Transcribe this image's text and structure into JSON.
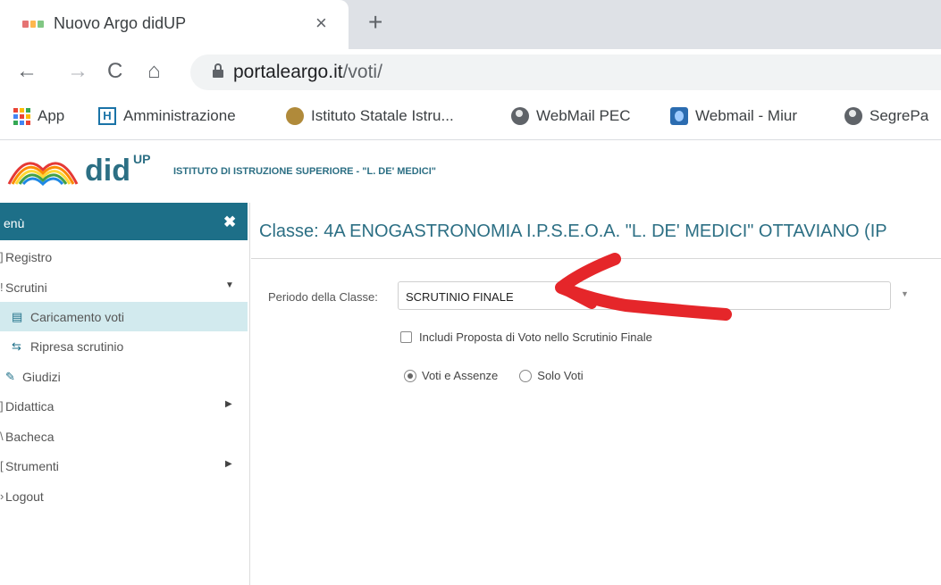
{
  "browser": {
    "tab_title": "Nuovo Argo didUP",
    "tab_close": "×",
    "new_tab": "+",
    "url_host": "portaleargo.it",
    "url_path": "/voti/",
    "nav": {
      "back": "←",
      "forward": "→",
      "reload": "C",
      "home": "⌂"
    }
  },
  "bookmarks": [
    {
      "label": "App",
      "icon": "apps-grid-icon"
    },
    {
      "label": "Amministrazione",
      "icon": "h-letter-icon"
    },
    {
      "label": "Istituto Statale Istru...",
      "icon": "seal-icon"
    },
    {
      "label": "WebMail PEC",
      "icon": "globe-icon"
    },
    {
      "label": "Webmail - Miur",
      "icon": "miur-icon"
    },
    {
      "label": "SegrePa",
      "icon": "globe-icon"
    }
  ],
  "app": {
    "logo_text": "did",
    "logo_sup": "UP",
    "school_name": "ISTITUTO DI ISTRUZIONE SUPERIORE - \"L. DE' MEDICI\""
  },
  "sidebar": {
    "header": "enù",
    "close_icon": "✖",
    "items": [
      {
        "label": "Registro",
        "icon": "]",
        "sub": false,
        "arrow": ""
      },
      {
        "label": "Scrutini",
        "icon": "!",
        "sub": false,
        "arrow": "▼"
      },
      {
        "label": "Caricamento voti",
        "icon": "▤",
        "sub": true,
        "active": true,
        "arrow": ""
      },
      {
        "label": "Ripresa scrutinio",
        "icon": "⇆",
        "sub": true,
        "arrow": ""
      },
      {
        "label": "Giudizi",
        "icon": "✎",
        "sub": false,
        "arrow": ""
      },
      {
        "label": "Didattica",
        "icon": "]",
        "sub": false,
        "arrow": "▶"
      },
      {
        "label": "Bacheca",
        "icon": "\\",
        "sub": false,
        "arrow": ""
      },
      {
        "label": "Strumenti",
        "icon": "[",
        "sub": false,
        "arrow": "▶"
      },
      {
        "label": "Logout",
        "icon": "›",
        "sub": false,
        "arrow": ""
      }
    ]
  },
  "main": {
    "title": "Classe: 4A ENOGASTRONOMIA I.P.S.E.O.A. \"L. DE' MEDICI\" OTTAVIANO (IP",
    "periodo_label": "Periodo della Classe:",
    "periodo_value": "SCRUTINIO FINALE",
    "select_caret": "▼",
    "checkbox_label": "Includi Proposta di Voto nello Scrutinio Finale",
    "checkbox_checked": false,
    "radio_options": [
      {
        "label": "Voti e Assenze",
        "checked": true
      },
      {
        "label": "Solo Voti",
        "checked": false
      }
    ]
  },
  "colors": {
    "accent": "#1d6f88",
    "active_bg": "#d2eaee",
    "annotation": "#e5262a"
  }
}
